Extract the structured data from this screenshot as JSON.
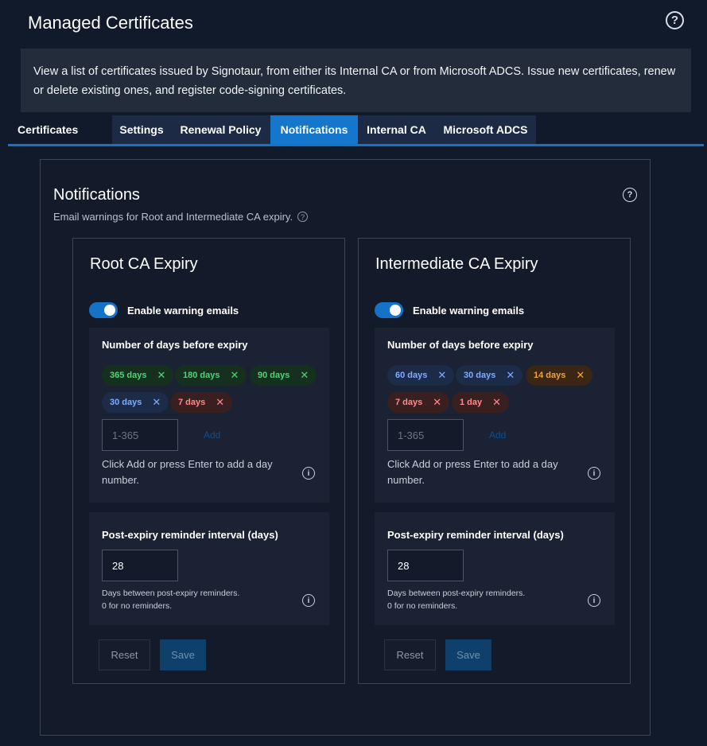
{
  "header": {
    "title": "Managed Certificates",
    "help_icon": "?"
  },
  "intro": {
    "text": "View a list of certificates issued by Signotaur, from either its Internal CA or from Microsoft ADCS. Issue new certificates, renew or delete existing ones, and register code-signing certificates."
  },
  "tabs": [
    {
      "label": "Certificates"
    },
    {
      "label": "Settings"
    },
    {
      "label": "Renewal Policy"
    },
    {
      "label": "Notifications",
      "active": true
    },
    {
      "label": "Internal CA"
    },
    {
      "label": "Microsoft ADCS"
    }
  ],
  "panel": {
    "title": "Notifications",
    "subtitle": "Email warnings for Root and Intermediate CA expiry.",
    "help_icon": "?"
  },
  "colors": {
    "accent": "#1577cc",
    "background": "#111a2a",
    "chip_green": "#53d27a",
    "chip_blue": "#80acff",
    "chip_orange": "#f0a53a",
    "chip_red": "#ff8a8a"
  },
  "cards": [
    {
      "title": "Root CA Expiry",
      "toggle_label": "Enable warning emails",
      "toggle_on": true,
      "days_label": "Number of days before expiry",
      "chips": [
        {
          "label": "365 days",
          "color": "green"
        },
        {
          "label": "180 days",
          "color": "green"
        },
        {
          "label": "90 days",
          "color": "green"
        },
        {
          "label": "30 days",
          "color": "blue"
        },
        {
          "label": "7 days",
          "color": "red"
        }
      ],
      "day_input_placeholder": "1-365",
      "add_label": "Add",
      "add_hint": "Click Add or press Enter to add a day number.",
      "interval_label": "Post-expiry reminder interval (days)",
      "interval_value": "28",
      "interval_hint_1": "Days between post-expiry reminders.",
      "interval_hint_2": "0 for no reminders.",
      "reset_label": "Reset",
      "save_label": "Save"
    },
    {
      "title": "Intermediate CA Expiry",
      "toggle_label": "Enable warning emails",
      "toggle_on": true,
      "days_label": "Number of days before expiry",
      "chips": [
        {
          "label": "60 days",
          "color": "blue"
        },
        {
          "label": "30 days",
          "color": "blue"
        },
        {
          "label": "14 days",
          "color": "orange"
        },
        {
          "label": "7 days",
          "color": "red"
        },
        {
          "label": "1 day",
          "color": "red"
        }
      ],
      "day_input_placeholder": "1-365",
      "add_label": "Add",
      "add_hint": "Click Add or press Enter to add a day number.",
      "interval_label": "Post-expiry reminder interval (days)",
      "interval_value": "28",
      "interval_hint_1": "Days between post-expiry reminders.",
      "interval_hint_2": "0 for no reminders.",
      "reset_label": "Reset",
      "save_label": "Save"
    }
  ]
}
